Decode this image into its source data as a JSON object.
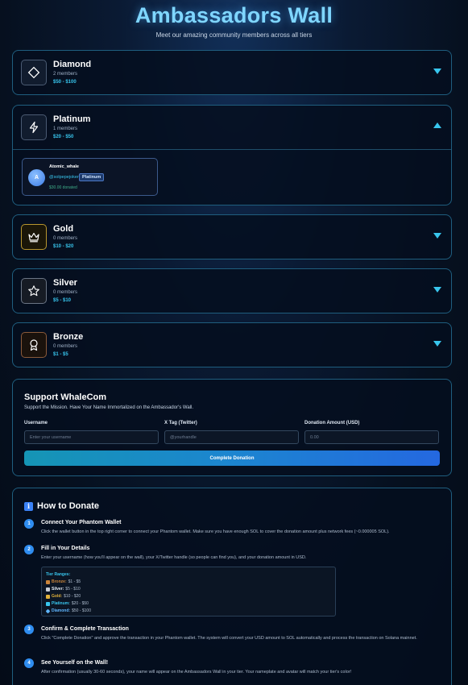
{
  "page": {
    "title": "Ambassadors Wall",
    "subtitle": "Meet our amazing community members across all tiers"
  },
  "tiers": [
    {
      "name": "Diamond",
      "members": "2 members",
      "range": "$50 - $100",
      "icon": "diamond-icon",
      "expanded": false
    },
    {
      "name": "Platinum",
      "members": "1 members",
      "range": "$20 - $50",
      "icon": "lightning-icon",
      "expanded": true
    },
    {
      "name": "Gold",
      "members": "0 members",
      "range": "$10 - $20",
      "icon": "crown-icon",
      "expanded": false
    },
    {
      "name": "Silver",
      "members": "0 members",
      "range": "$5 - $10",
      "icon": "star-icon",
      "expanded": false
    },
    {
      "name": "Bronze",
      "members": "0 members",
      "range": "$1 - $5",
      "icon": "award-icon",
      "expanded": false
    }
  ],
  "platinum_member": {
    "avatar_letter": "A",
    "name": "Atomic_whale",
    "handle": "@solpepejoker",
    "badge": "Platinum",
    "donated": "$30.00 donated"
  },
  "support": {
    "title": "Support WhaleCom",
    "subtitle": "Support the Mission. Have Your Name Immortalized on the Ambassador's Wall.",
    "username_label": "Username",
    "username_placeholder": "Enter your username",
    "xtag_label": "X Tag (Twitter)",
    "xtag_placeholder": "@yourhandle",
    "amount_label": "Donation Amount (USD)",
    "amount_placeholder": "0.00",
    "button_label": "Complete Donation"
  },
  "howto": {
    "title": "How to Donate",
    "steps": [
      {
        "num": "1",
        "title": "Connect Your Phantom Wallet",
        "text": "Click the wallet button in the top right corner to connect your Phantom wallet. Make sure you have enough SOL to cover the donation amount plus network fees (~0.000005 SOL)."
      },
      {
        "num": "2",
        "title": "Fill in Your Details",
        "text": "Enter your username (how you'll appear on the wall), your X/Twitter handle (so people can find you), and your donation amount in USD."
      },
      {
        "num": "3",
        "title": "Confirm & Complete Transaction",
        "text": "Click \"Complete Donation\" and approve the transaction in your Phantom wallet. The system will convert your USD amount to SOL automatically and process the transaction on Solana mainnet."
      },
      {
        "num": "4",
        "title": "See Yourself on the Wall!",
        "text": "After confirmation (usually 30-60 seconds), your name will appear on the Ambassadors Wall in your tier. Your nameplate and avatar will match your tier's color!"
      }
    ],
    "ranges_title": "Tier Ranges:",
    "ranges": [
      {
        "tier": "Bronze:",
        "range": "$1 - $5",
        "color": "#c9843a"
      },
      {
        "tier": "Silver:",
        "range": "$5 - $10",
        "color": "#c7cdd6"
      },
      {
        "tier": "Gold:",
        "range": "$10 - $20",
        "color": "#e2b23a"
      },
      {
        "tier": "Platinum:",
        "range": "$20 - $50",
        "color": "#38c6ee"
      },
      {
        "tier": "Diamond:",
        "range": "$50 - $100",
        "color": "#5fb6ff"
      }
    ]
  },
  "colors": {
    "accent": "#38c6ee",
    "title": "#7fd6ff",
    "gold_border": "#b8962e",
    "bronze_border": "#8a5a3a"
  }
}
